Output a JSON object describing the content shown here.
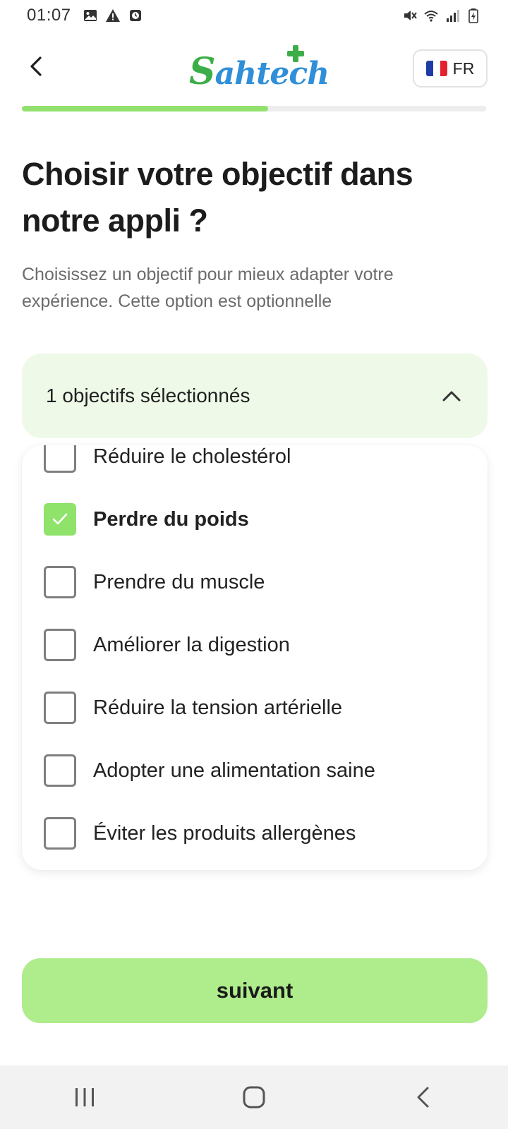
{
  "status_bar": {
    "time": "01:07",
    "left_icons": [
      "image-icon",
      "warning-icon",
      "clock-icon"
    ],
    "right_icons": [
      "mute-icon",
      "wifi-icon",
      "signal-icon",
      "battery-icon"
    ]
  },
  "header": {
    "back_icon": "chevron-left-icon",
    "logo_first_letter": "S",
    "logo_rest": "ahtech",
    "language": {
      "code": "FR",
      "flag": "france-flag-icon"
    }
  },
  "progress": {
    "value": 0.53
  },
  "page": {
    "title": "Choisir votre objectif dans notre appli ?",
    "subtitle": "Choisissez un objectif pour mieux adapter votre expérience. Cette option est optionnelle"
  },
  "dropdown": {
    "summary": "1 objectifs sélectionnés",
    "toggle_icon": "chevron-up-icon",
    "options": [
      {
        "label": "Réduire le cholestérol",
        "checked": false
      },
      {
        "label": "Perdre du poids",
        "checked": true
      },
      {
        "label": "Prendre du muscle",
        "checked": false
      },
      {
        "label": "Améliorer la digestion",
        "checked": false
      },
      {
        "label": "Réduire la tension artérielle",
        "checked": false
      },
      {
        "label": "Adopter une alimentation saine",
        "checked": false
      },
      {
        "label": "Éviter les produits allergènes",
        "checked": false
      }
    ]
  },
  "cta": {
    "label": "suivant"
  },
  "navigation_bar": {
    "buttons": [
      "recent-apps-icon",
      "home-icon",
      "back-icon"
    ]
  },
  "colors": {
    "brand_green": "#3cae49",
    "brand_blue": "#2f8fd8",
    "accent_green": "#92e06e",
    "button_green": "#aeec8c",
    "dropdown_bg": "#eef9e8"
  }
}
